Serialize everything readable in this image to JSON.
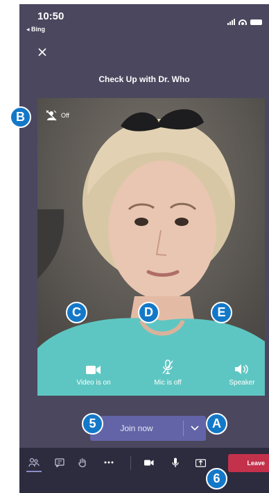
{
  "status_bar": {
    "time": "10:50",
    "back_label": "◂ Bing"
  },
  "meeting": {
    "title": "Check Up with Dr. Who"
  },
  "background_effects": {
    "label": "Off"
  },
  "controls": {
    "video_label": "Video is on",
    "mic_label": "Mic is off",
    "speaker_label": "Speaker"
  },
  "join": {
    "label": "Join now"
  },
  "toolbar": {
    "leave_label": "Leave"
  },
  "callouts": {
    "a": "A",
    "b": "B",
    "c": "C",
    "d": "D",
    "e": "E",
    "five": "5",
    "six": "6"
  },
  "colors": {
    "background": "#4b475e",
    "accent": "#6264a7",
    "toolbar": "#2d2b3e",
    "leave": "#c4314b",
    "callout": "#1478c8"
  },
  "icons": {
    "close": "close-icon",
    "background_effects": "background-blur-icon",
    "video": "video-camera-icon",
    "mic": "mic-off-icon",
    "speaker": "speaker-icon",
    "dropdown": "chevron-down-icon",
    "people": "people-icon",
    "chat": "chat-icon",
    "raise_hand": "raise-hand-icon",
    "more": "more-icon",
    "camera": "camera-icon",
    "microphone": "microphone-icon",
    "share": "share-icon",
    "leave": "phone-hangup-icon"
  }
}
